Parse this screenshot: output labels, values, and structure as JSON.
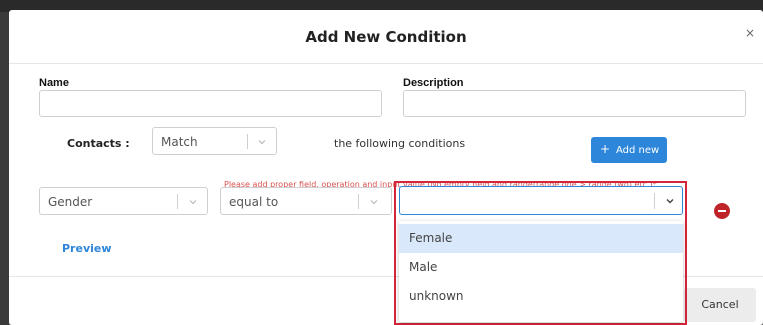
{
  "modal": {
    "title": "Add New Condition",
    "close_glyph": "×"
  },
  "form": {
    "name_label": "Name",
    "name_value": "",
    "description_label": "Description",
    "description_value": ""
  },
  "contacts": {
    "label": "Contacts :",
    "match_value": "Match",
    "following_text": "the following conditions",
    "add_button_icon": "+",
    "add_button_label": "Add new"
  },
  "warning": "Please add proper field, operation and input value (No empty field and range(range one > range two) etc.)*",
  "condition": {
    "field_value": "Gender",
    "operation_value": "equal to",
    "input_value": ""
  },
  "dropdown": {
    "options": [
      "Female",
      "Male",
      "unknown"
    ],
    "highlighted_option": "Female"
  },
  "preview_label": "Preview",
  "footer": {
    "cancel_label": "Cancel"
  },
  "colors": {
    "accent": "#2d86d9",
    "danger": "#c0242b",
    "warning_text": "#d9534f",
    "highlight_border": "#d4263a",
    "option_highlight": "#d9e8fb",
    "primary_orange": "#f0a531"
  },
  "icons": [
    "close-icon",
    "plus-icon",
    "chevron-down-icon",
    "remove-icon"
  ]
}
